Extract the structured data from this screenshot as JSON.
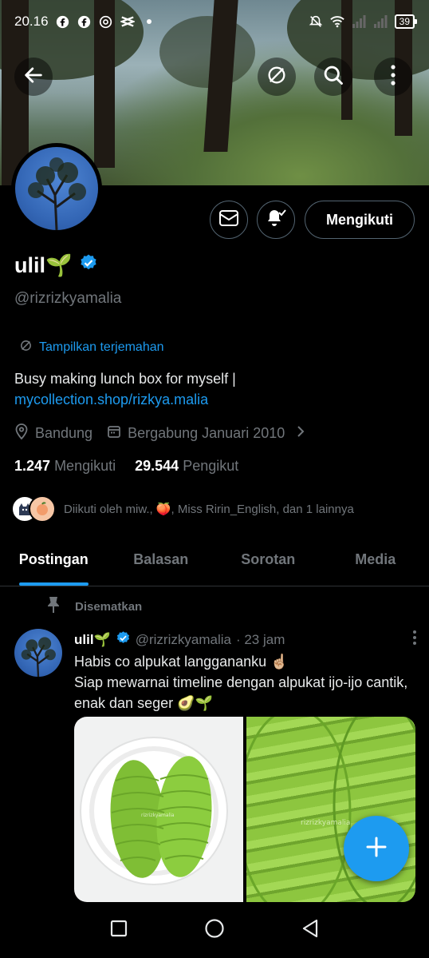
{
  "status_bar": {
    "time": "20.16",
    "battery": "39",
    "icons": [
      "facebook-icon",
      "facebook-icon",
      "threads-icon",
      "capcut-icon",
      "dot-icon",
      "mute-icon",
      "wifi-icon",
      "signal-icon",
      "signal-icon"
    ]
  },
  "header": {
    "back_icon": "arrow-left-icon",
    "translate_icon": "translate-icon",
    "search_icon": "search-icon",
    "more_icon": "more-vertical-icon"
  },
  "profile": {
    "name": "ulil🌱",
    "handle": "@rizrizkyamalia",
    "translate_label": "Tampilkan terjemahan",
    "bio_text": "Busy making lunch box for myself | ",
    "bio_link": "mycollection.shop/rizkya.malia",
    "location": "Bandung",
    "joined": "Bergabung Januari 2010",
    "following_count": "1.247",
    "following_label": "Mengikuti",
    "followers_count": "29.544",
    "followers_label": "Pengikut",
    "followed_by": "Diikuti oleh miw., 🍑, Miss Ririn_English, dan 1 lainnya",
    "follow_button": "Mengikuti"
  },
  "tabs": [
    {
      "label": "Postingan",
      "active": true
    },
    {
      "label": "Balasan",
      "active": false
    },
    {
      "label": "Sorotan",
      "active": false
    },
    {
      "label": "Media",
      "active": false
    }
  ],
  "post": {
    "pinned_label": "Disematkan",
    "author": "ulil🌱",
    "handle": "@rizrizkyamalia",
    "time": "· 23 jam",
    "line1": "Habis co alpukat langgananku ☝🏼",
    "line2": "Siap mewarnai timeline dengan alpukat ijo-ijo cantik, enak dan seger 🥑🌱",
    "watermark": "rizrizkyamalia"
  },
  "colors": {
    "accent": "#1d9bf0",
    "muted": "#71767b",
    "border": "#536471",
    "background": "#000000"
  }
}
